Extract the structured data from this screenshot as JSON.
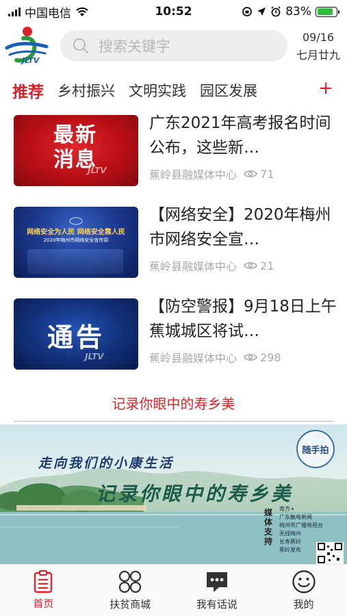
{
  "status_bar": {
    "carrier": "中国电信",
    "time": "10:52",
    "battery": "83%",
    "battery_level": 0.83
  },
  "header": {
    "logo_text": "JLTV",
    "search_placeholder": "搜索关键字",
    "date": "09/16",
    "lunar_date": "七月廿九"
  },
  "tabs": [
    {
      "label": "推荐",
      "active": true
    },
    {
      "label": "乡村振兴"
    },
    {
      "label": "文明实践"
    },
    {
      "label": "园区发展"
    }
  ],
  "add_tab_icon": "+",
  "news": [
    {
      "title": "广东2021年高考报名时间公布，这些新…",
      "source": "蕉岭县融媒体中心",
      "views": "71",
      "thumb_text": [
        "最新",
        "消息"
      ],
      "thumb_watermark": "JLTV"
    },
    {
      "title": "【网络安全】2020年梅州市网络安全宣…",
      "source": "蕉岭县融媒体中心",
      "views": "21",
      "thumb_text": [
        "网络安全为人民  网络安全靠人民",
        "2020年梅州市网络安全宣传周"
      ]
    },
    {
      "title": "【防空警报】9月18日上午蕉城城区将试…",
      "source": "蕉岭县融媒体中心",
      "views": "298",
      "thumb_text": [
        "通告"
      ],
      "thumb_watermark": "JLTV"
    }
  ],
  "section": {
    "title": "记录你眼中的寿乡美"
  },
  "banner": {
    "slogan": "走向我们的小康生活",
    "headline": "记录你眼中的寿乡美",
    "stamp": "随手拍",
    "media_label": "媒体支持",
    "media_list": [
      "南方+",
      "广东触电新闻",
      "梅州市广播电视台",
      "无线梅州",
      "长寿蕉岭",
      "蕉岭发布"
    ]
  },
  "bottom_nav": [
    {
      "label": "首页",
      "icon": "clipboard-icon",
      "active": true
    },
    {
      "label": "扶贫商城",
      "icon": "grid-icon"
    },
    {
      "label": "我有话说",
      "icon": "chat-icon"
    },
    {
      "label": "我的",
      "icon": "smile-icon"
    }
  ],
  "colors": {
    "accent": "#d8232a",
    "search_bg": "#ededed",
    "meta_text": "#a9a9a9"
  }
}
